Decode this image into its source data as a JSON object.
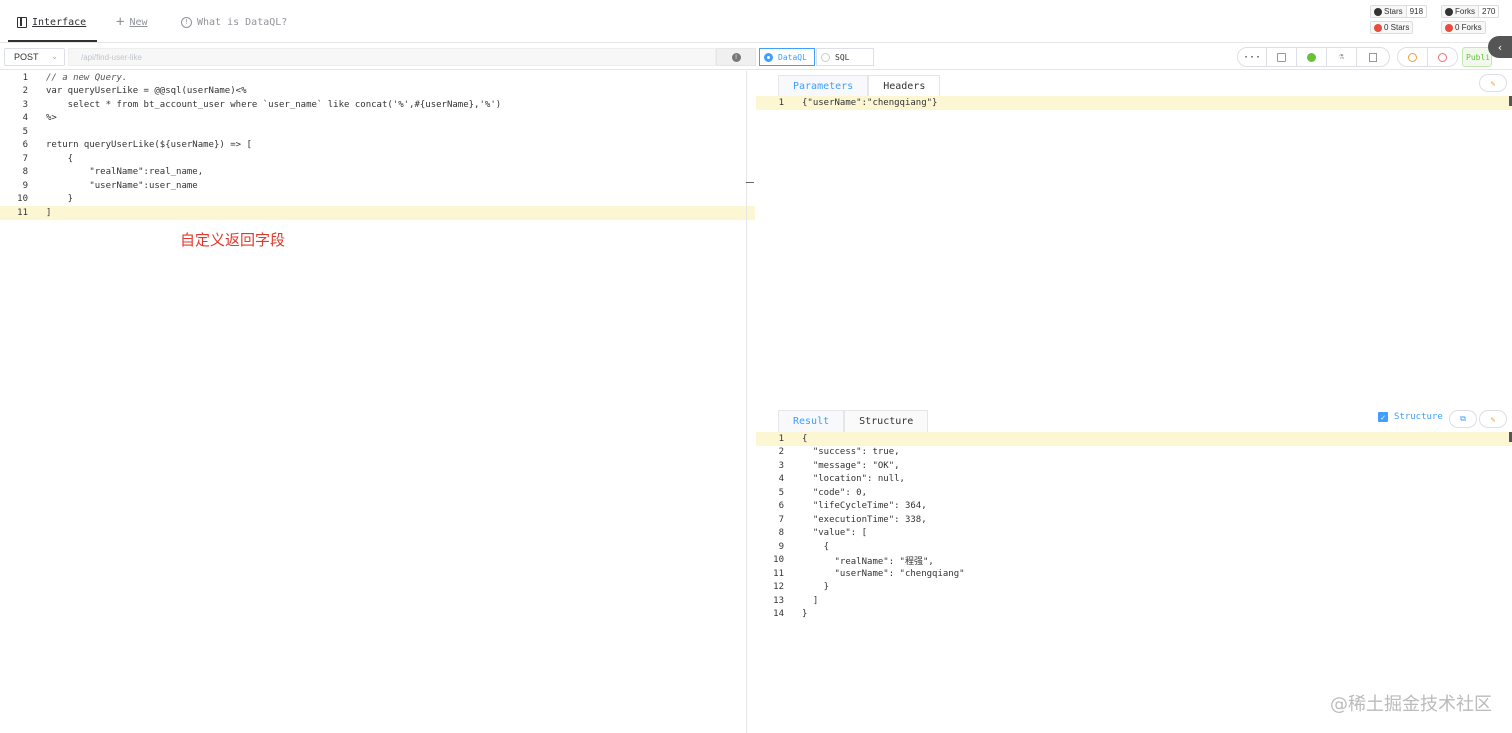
{
  "nav": {
    "interface_label": "Interface",
    "new_label": "New",
    "what_label": "What is DataQL?"
  },
  "badges": [
    {
      "label": "Stars",
      "value": "918"
    },
    {
      "label": "Forks",
      "value": "270"
    },
    {
      "label": "0 Stars"
    },
    {
      "label": "0 Forks"
    }
  ],
  "toolbar": {
    "method": "POST",
    "url_placeholder": "/api/find-user-like",
    "mode_dataql": "DataQL",
    "mode_sql": "SQL",
    "more_label": "···",
    "publish_label": "Publi..."
  },
  "code_left": [
    "// a new Query.",
    "var queryUserLike = @@sql(userName)<%",
    "    select * from bt_account_user where `user_name` like concat('%',#{userName},'%')",
    "%>",
    "",
    "return queryUserLike(${userName}) => [",
    "    {",
    "        \"realName\":real_name,",
    "        \"userName\":user_name",
    "    }",
    "]"
  ],
  "annotation": "自定义返回字段",
  "request_tabs": [
    "Parameters",
    "Headers"
  ],
  "request_code": [
    "{\"userName\":\"chengqiang\"}"
  ],
  "result_tabs": [
    "Result",
    "Structure"
  ],
  "structure_label": "Structure",
  "result_code": [
    "{",
    "  \"success\": true,",
    "  \"message\": \"OK\",",
    "  \"location\": null,",
    "  \"code\": 0,",
    "  \"lifeCycleTime\": 364,",
    "  \"executionTime\": 338,",
    "  \"value\": [",
    "    {",
    "      \"realName\": \"程强\",",
    "      \"userName\": \"chengqiang\"",
    "    }",
    "  ]",
    "}"
  ],
  "watermark": "@稀土掘金技术社区",
  "colors": {
    "accent": "#409eff",
    "highlight": "#fdf6d3",
    "annotation": "#e0392b"
  }
}
